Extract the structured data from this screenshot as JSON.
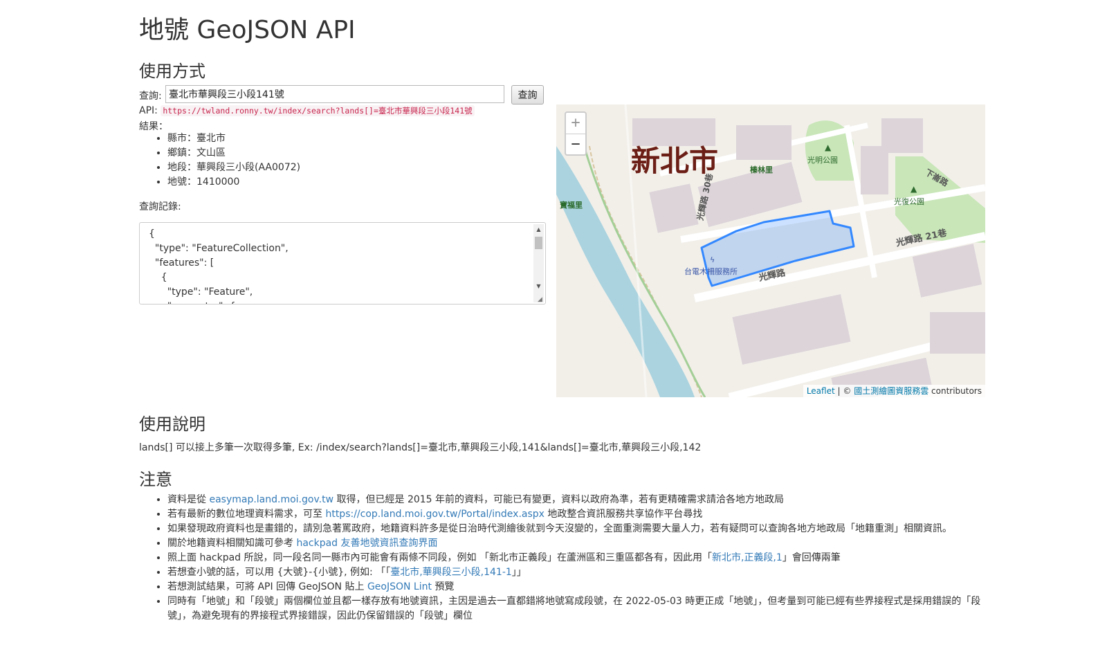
{
  "page": {
    "title": "地號 GeoJSON API"
  },
  "usage": {
    "heading": "使用方式",
    "query_label": "查詢:",
    "query_value": "臺北市華興段三小段141號",
    "query_button": "查詢",
    "api_label": "API:",
    "api_url": "https://twland.ronny.tw/index/search?lands[]=臺北市華興段三小段141號",
    "result_label": "結果：",
    "results": [
      "縣市：臺北市",
      "鄉鎮：文山區",
      "地段：華興段三小段(AA0072)",
      "地號：1410000"
    ],
    "log_label": "查詢記錄:",
    "log_text": "{\n  \"type\": \"FeatureCollection\",\n  \"features\": [\n    {\n      \"type\": \"Feature\",\n      \"geometry\": {"
  },
  "map": {
    "zoom_in": "+",
    "zoom_out": "−",
    "city_label": "新北市",
    "labels": {
      "a": "光明公園",
      "b": "光復公園",
      "c": "寶福里",
      "d": "榛林里",
      "e": "光輝路 21巷",
      "f": "光輝路",
      "g": "台電木柵服務所",
      "h": "光輝路 30巷",
      "i": "下崙路"
    },
    "attribution_leaflet": "Leaflet",
    "attribution_sep": " | © ",
    "attribution_source": "國土測繪圖資服務雲",
    "attribution_tail": " contributors",
    "polygon_color": "#3388ff"
  },
  "explain": {
    "heading": "使用說明",
    "text": "lands[] 可以接上多筆一次取得多筆, Ex: /index/search?lands[]=臺北市,華興段三小段,141&lands[]=臺北市,華興段三小段,142"
  },
  "notes": {
    "heading": "注意",
    "n1_pre": "資料是從 ",
    "n1_link": "easymap.land.moi.gov.tw",
    "n1_post": " 取得，但已經是 2015 年前的資料，可能已有變更，資料以政府為準，若有更精確需求請洽各地方地政局",
    "n2_pre": "若有最新的數位地理資料需求，可至 ",
    "n2_link": "https://cop.land.moi.gov.tw/Portal/index.aspx",
    "n2_post": " 地政整合資訊服務共享協作平台尋找",
    "n3": "如果發現政府資料也是畫錯的，請別急著罵政府，地籍資料許多是從日治時代測繪後就到今天沒變的，全面重測需要大量人力，若有疑問可以查詢各地方地政局「地籍重測」相關資訊。",
    "n4_pre": "關於地籍資料相關知識可參考 ",
    "n4_link": "hackpad 友善地號資訊查詢界面",
    "n5_pre": "照上面 hackpad 所說，同一段名同一縣市內可能會有兩條不同段，例如 「新北市正義段」在蘆洲區和三重區都各有，因此用「",
    "n5_link": "新北市,正義段,1",
    "n5_post": "」會回傳兩筆",
    "n6_pre": "若想查小號的話，可以用 {大號}-{小號}, 例如: 「「",
    "n6_link": "臺北市,華興段三小段,141-1",
    "n6_post": "」」",
    "n7_pre": "若想測試結果，可將 API 回傳 GeoJSON 貼上 ",
    "n7_link": "GeoJSON Lint",
    "n7_post": " 預覽",
    "n8": "同時有「地號」和「段號」兩個欄位並且都一樣存放有地號資訊，主因是過去一直都錯將地號寫成段號，在 2022-05-03 時更正成「地號」，但考量到可能已經有些界接程式是採用錯誤的「段號」，為避免現有的界接程式界接錯誤，因此仍保留錯誤的「段號」欄位"
  }
}
